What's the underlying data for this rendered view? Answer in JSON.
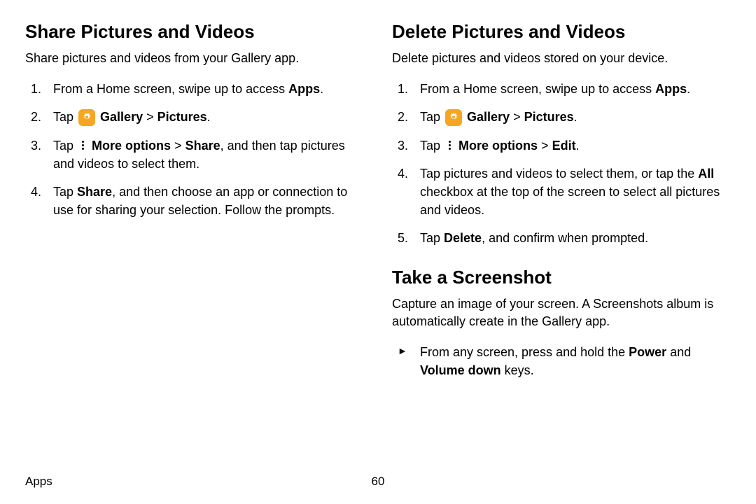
{
  "left": {
    "heading": "Share Pictures and Videos",
    "intro": "Share pictures and videos from your Gallery app.",
    "step1_a": "From a Home screen, swipe up to access ",
    "step1_b": "Apps",
    "step1_c": ".",
    "step2_a": "Tap ",
    "step2_b": "Gallery",
    "step2_c": " > ",
    "step2_d": "Pictures",
    "step2_e": ".",
    "step3_a": "Tap ",
    "step3_b": "More options",
    "step3_c": " > ",
    "step3_d": "Share",
    "step3_e": ", and then tap pictures and videos to select them.",
    "step4_a": "Tap ",
    "step4_b": "Share",
    "step4_c": ", and then choose an app or connection to use for sharing your selection. Follow the prompts."
  },
  "right1": {
    "heading": "Delete Pictures and Videos",
    "intro": "Delete pictures and videos stored on your device.",
    "step1_a": "From a Home screen, swipe up to access ",
    "step1_b": "Apps",
    "step1_c": ".",
    "step2_a": "Tap ",
    "step2_b": "Gallery",
    "step2_c": " > ",
    "step2_d": "Pictures",
    "step2_e": ".",
    "step3_a": "Tap ",
    "step3_b": "More options",
    "step3_c": " > ",
    "step3_d": "Edit",
    "step3_e": ".",
    "step4_a": "Tap pictures and videos to select them, or tap the ",
    "step4_b": "All",
    "step4_c": " checkbox at the top of the screen to select all pictures and videos.",
    "step5_a": "Tap ",
    "step5_b": "Delete",
    "step5_c": ", and confirm when prompted."
  },
  "right2": {
    "heading": "Take a Screenshot",
    "intro": "Capture an image of your screen. A Screenshots album is automatically create in the Gallery app.",
    "bullet_a": "From any screen, press and hold the ",
    "bullet_b": "Power",
    "bullet_c": " and ",
    "bullet_d": "Volume down",
    "bullet_e": " keys."
  },
  "footer": {
    "label": "Apps",
    "page": "60"
  }
}
